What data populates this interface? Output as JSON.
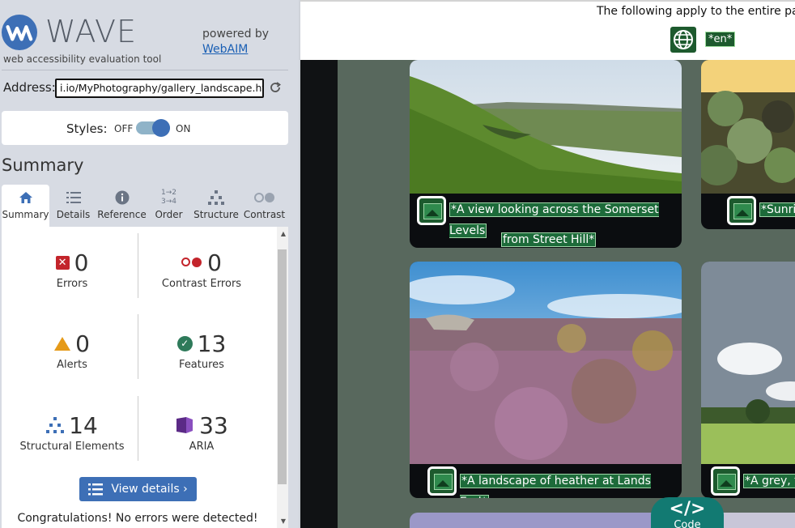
{
  "wave": {
    "title": "WAVE",
    "subtitle": "web accessibility evaluation tool",
    "powered_by": "powered by",
    "webaim_link": "WebAIM",
    "address_label": "Address:",
    "address_value": "i.io/MyPhotography/gallery_landscape.html",
    "styles_label": "Styles:",
    "styles_off": "OFF",
    "styles_on": "ON",
    "styles_toggle_state": "on",
    "summary_heading": "Summary",
    "tabs": [
      {
        "label": "Summary",
        "icon": "home-icon",
        "active": true
      },
      {
        "label": "Details",
        "icon": "list-icon",
        "active": false
      },
      {
        "label": "Reference",
        "icon": "info-icon",
        "active": false
      },
      {
        "label": "Order",
        "icon": "order-icon",
        "active": false
      },
      {
        "label": "Structure",
        "icon": "structure-icon",
        "active": false
      },
      {
        "label": "Contrast",
        "icon": "contrast-icon",
        "active": false
      }
    ],
    "stats": {
      "errors": {
        "value": "0",
        "label": "Errors"
      },
      "contrast_errors": {
        "value": "0",
        "label": "Contrast Errors"
      },
      "alerts": {
        "value": "0",
        "label": "Alerts"
      },
      "features": {
        "value": "13",
        "label": "Features"
      },
      "structural": {
        "value": "14",
        "label": "Structural Elements"
      },
      "aria": {
        "value": "33",
        "label": "ARIA"
      }
    },
    "view_details": "View details ›",
    "congrats": "Congratulations! No errors were detected!"
  },
  "page": {
    "top_text": "The following apply to the entire page",
    "lang_badge": "*en*",
    "cards": [
      {
        "alt_line1": "*A view looking across the Somerset Levels",
        "alt_line2": "from Street Hill*"
      },
      {
        "alt_line1": "*Sunri"
      },
      {
        "alt_line1": "*A landscape of heather at Lands End*"
      },
      {
        "alt_line1": "*A grey, t"
      }
    ],
    "code_tab": "Code",
    "code_symbol": "</>"
  },
  "colors": {
    "wave_blue": "#3d6fb6",
    "error_red": "#c3242b",
    "alert_orange": "#e59a19",
    "feature_green": "#2e7a5a",
    "alt_green": "#1d6b3a",
    "code_teal": "#127a72"
  }
}
